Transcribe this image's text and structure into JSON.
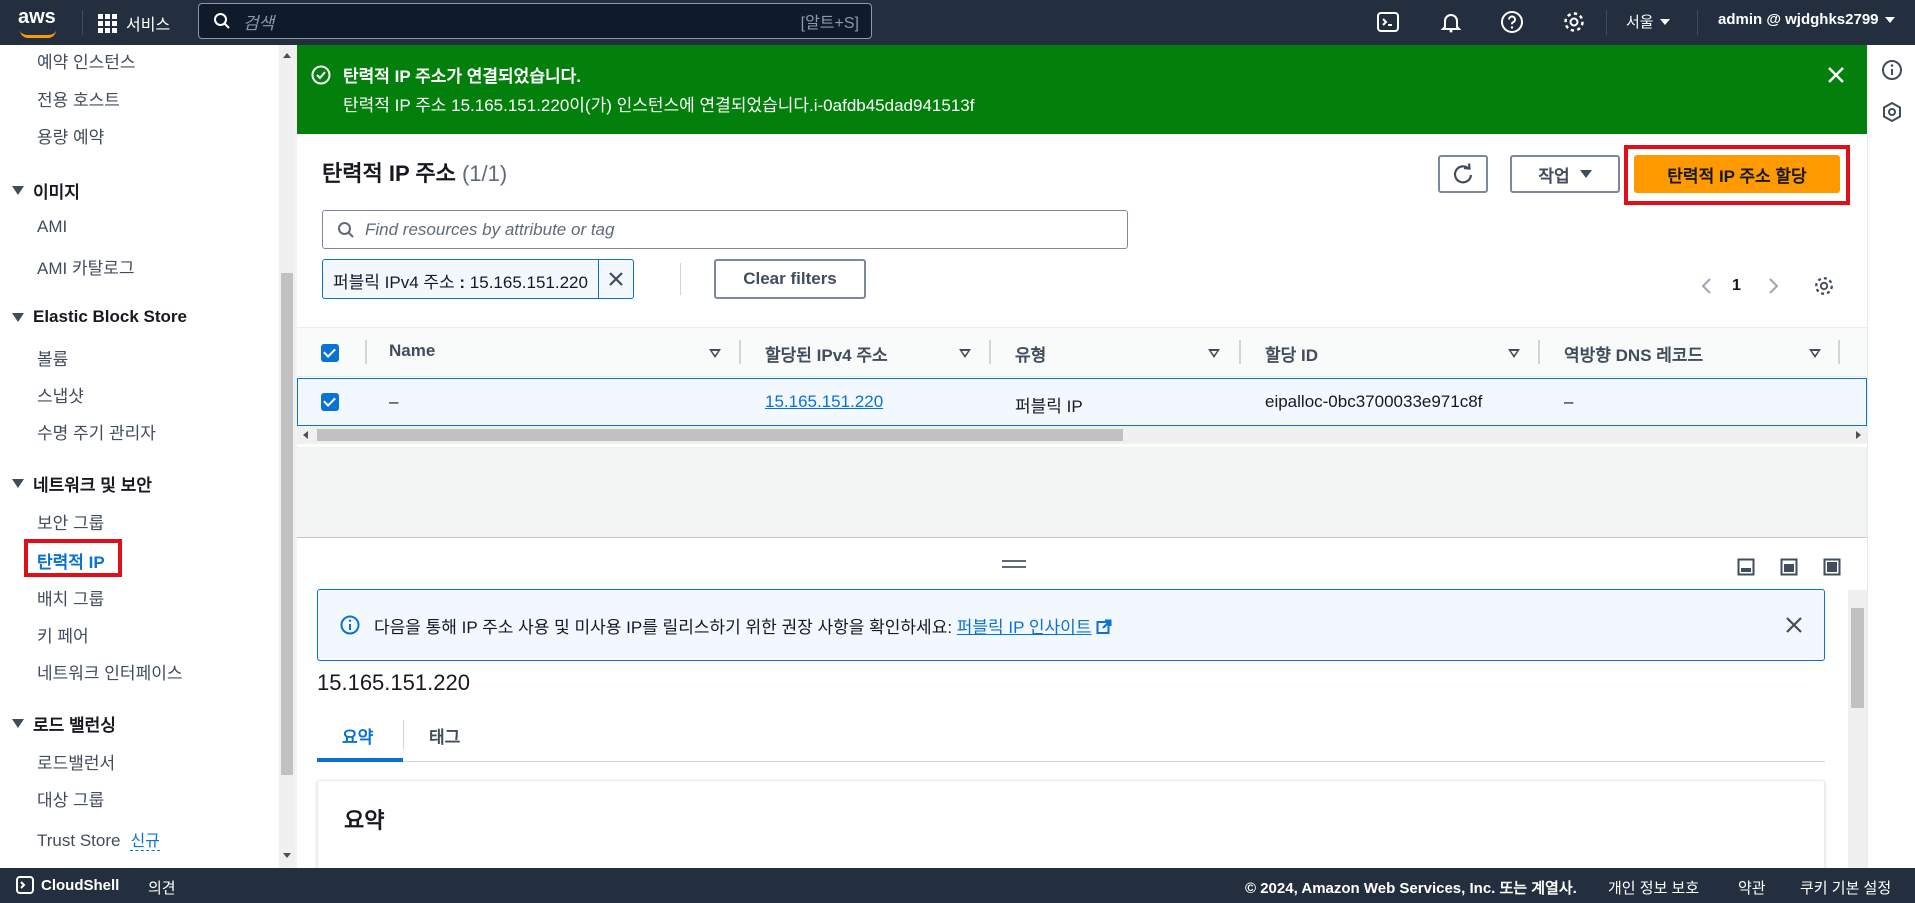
{
  "topnav": {
    "logo_text": "aws",
    "services_label": "서비스",
    "search_placeholder": "검색",
    "search_shortcut": "[알트+S]",
    "region": "서울",
    "account": "admin @ wjdghks2799"
  },
  "sidebar": {
    "items_top": [
      "예약 인스턴스",
      "전용 호스트",
      "용량 예약"
    ],
    "sections": [
      {
        "title": "이미지",
        "items": [
          "AMI",
          "AMI 카탈로그"
        ]
      },
      {
        "title": "Elastic Block Store",
        "items": [
          "볼륨",
          "스냅샷",
          "수명 주기 관리자"
        ]
      },
      {
        "title": "네트워크 및 보안",
        "items": [
          "보안 그룹",
          "탄력적 IP",
          "배치 그룹",
          "키 페어",
          "네트워크 인터페이스"
        ]
      },
      {
        "title": "로드 밸런싱",
        "items": [
          "로드밸런서",
          "대상 그룹",
          "Trust Store"
        ]
      }
    ],
    "active_item": "탄력적 IP",
    "new_badge": "신규"
  },
  "flash": {
    "title": "탄력적 IP 주소가 연결되었습니다.",
    "message": "탄력적 IP 주소 15.165.151.220이(가) 인스턴스에 연결되었습니다.i-0afdb45dad941513f"
  },
  "panel": {
    "title": "탄력적 IP 주소",
    "count": "(1/1)",
    "actions_label": "작업",
    "allocate_label": "탄력적 IP 주소 할당",
    "filter_placeholder": "Find resources by attribute or tag",
    "token_key": "퍼블릭 IPv4 주소",
    "token_op": " : ",
    "token_value": "15.165.151.220",
    "clear_filters": "Clear filters",
    "page_number": "1"
  },
  "table": {
    "columns": [
      "Name",
      "할당된 IPv4 주소",
      "유형",
      "할당 ID",
      "역방향 DNS 레코드"
    ],
    "rows": [
      {
        "name": "–",
        "ipv4": "15.165.151.220",
        "type": "퍼블릭 IP",
        "allocation_id": "eipalloc-0bc3700033e971c8f",
        "reverse_dns": "–"
      }
    ]
  },
  "split": {
    "info_text": "다음을 통해 IP 주소 사용 및 미사용 IP를 릴리스하기 위한 권장 사항을 확인하세요: ",
    "info_link": "퍼블릭 IP 인사이트",
    "ip_title": "15.165.151.220",
    "tabs": [
      "요약",
      "태그"
    ],
    "summary_heading": "요약"
  },
  "footer": {
    "cloudshell": "CloudShell",
    "feedback": "의견",
    "copyright": "© 2024, Amazon Web Services, Inc. 또는 계열사.",
    "privacy": "개인 정보 보호",
    "terms": "약관",
    "cookies": "쿠키 기본 설정"
  },
  "colors": {
    "nav_bg": "#232f3e",
    "success": "#037f0c",
    "primary": "#ff9900",
    "link": "#0972d3",
    "highlight": "#e0101a"
  }
}
